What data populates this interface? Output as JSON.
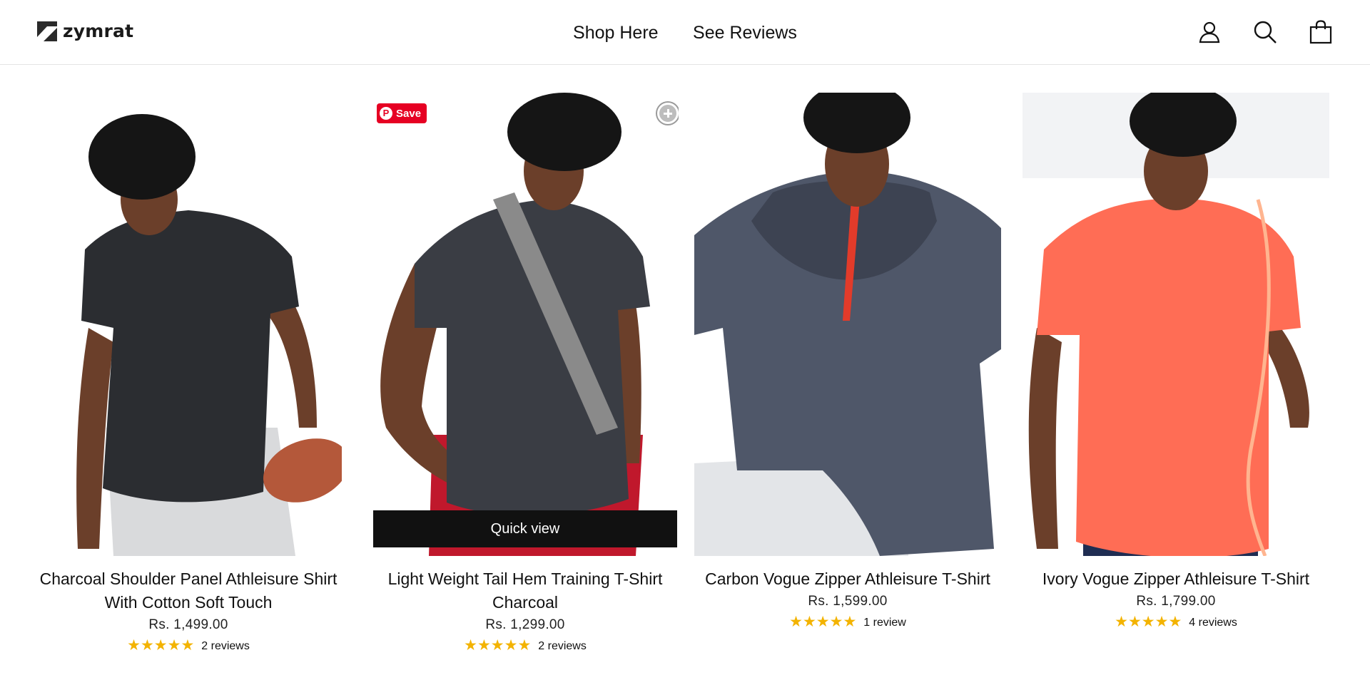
{
  "brand": {
    "name": "zymrat"
  },
  "nav": [
    {
      "label": "Shop Here"
    },
    {
      "label": "See Reviews"
    }
  ],
  "header_icons": [
    "account-icon",
    "search-icon",
    "cart-icon"
  ],
  "products": [
    {
      "title": "Charcoal Shoulder Panel Athleisure Shirt With Cotton Soft Touch",
      "price": "Rs. 1,499.00",
      "stars": "★★★★★",
      "reviews": "2 reviews",
      "shirt_color": "#2b2d31"
    },
    {
      "title": "Light Weight Tail Hem Training T-Shirt Charcoal",
      "price": "Rs. 1,299.00",
      "stars": "★★★★★",
      "reviews": "2 reviews",
      "shirt_color": "#3a3d44",
      "save_label": "Save",
      "quick_view_label": "Quick view"
    },
    {
      "title": "Carbon Vogue Zipper Athleisure T-Shirt",
      "price": "Rs. 1,599.00",
      "stars": "★★★★★",
      "reviews": "1 review",
      "shirt_color": "#4f5769"
    },
    {
      "title": "Ivory Vogue Zipper Athleisure T-Shirt",
      "price": "Rs. 1,799.00",
      "stars": "★★★★★",
      "reviews": "4 reviews",
      "shirt_color": "#ff6d55"
    }
  ],
  "colors": {
    "star": "#f3b300",
    "pinterest": "#e60023",
    "quick_view_bg": "#111111"
  }
}
